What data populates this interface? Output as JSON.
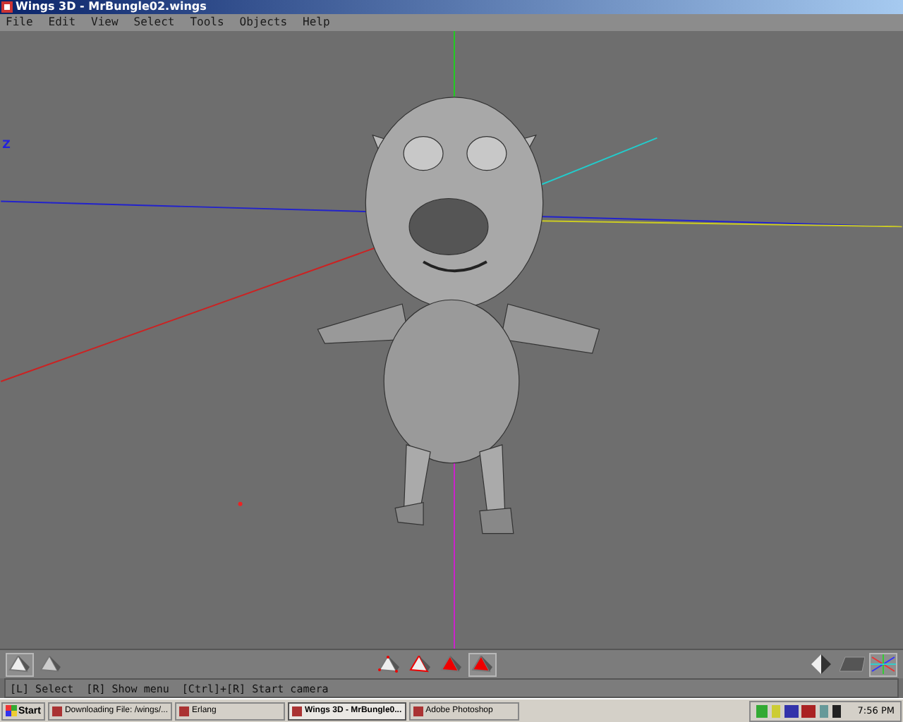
{
  "window": {
    "title": "Wings 3D - MrBungle02.wings"
  },
  "menu": [
    "File",
    "Edit",
    "View",
    "Select",
    "Tools",
    "Objects",
    "Help"
  ],
  "viewport": {
    "axis_label": "Z"
  },
  "toolbar": {
    "modes": [
      {
        "kind": "flat",
        "selected": true
      },
      {
        "kind": "smooth",
        "selected": false
      }
    ],
    "select_modes": [
      {
        "kind": "vertex",
        "selected": false
      },
      {
        "kind": "edge",
        "selected": false
      },
      {
        "kind": "face",
        "selected": false
      },
      {
        "kind": "body",
        "selected": true
      }
    ],
    "views": [
      {
        "kind": "shaded",
        "selected": false
      },
      {
        "kind": "grid",
        "selected": false
      },
      {
        "kind": "axes",
        "selected": true
      }
    ]
  },
  "status_bar": "[L] Select  [R] Show menu  [Ctrl]+[R] Start camera",
  "taskbar": {
    "start": "Start",
    "tasks": [
      {
        "label": "Downloading File: /wings/...",
        "selected": false
      },
      {
        "label": "Erlang",
        "selected": false
      },
      {
        "label": "Wings 3D - MrBungle0...",
        "selected": true
      },
      {
        "label": "Adobe Photoshop",
        "selected": false
      }
    ],
    "clock": "7:56 PM"
  }
}
